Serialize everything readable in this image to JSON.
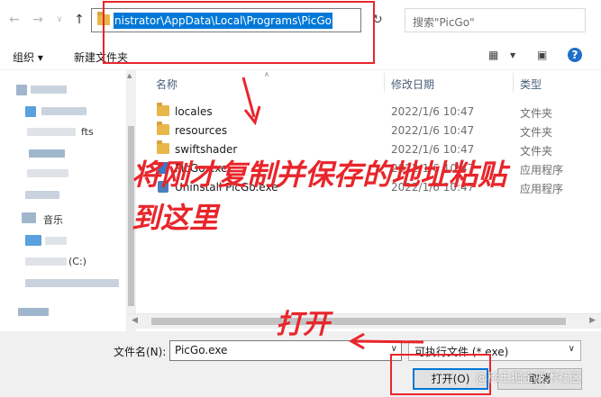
{
  "address": {
    "path": "nistrator\\AppData\\Local\\Programs\\PicGo",
    "search_placeholder": "搜索\"PicGo\""
  },
  "toolbar": {
    "organize": "组织 ▾",
    "new_folder": "新建文件夹"
  },
  "leftnav": {
    "visible_fragments": [
      "fts",
      "音乐",
      "(C:)"
    ]
  },
  "columns": {
    "name": "名称",
    "modified": "修改日期",
    "type": "类型"
  },
  "files": [
    {
      "name": "locales",
      "date": "2022/1/6 10:47",
      "type": "文件夹",
      "kind": "folder"
    },
    {
      "name": "resources",
      "date": "2022/1/6 10:47",
      "type": "文件夹",
      "kind": "folder"
    },
    {
      "name": "swiftshader",
      "date": "2022/1/6 10:47",
      "type": "文件夹",
      "kind": "folder"
    },
    {
      "name": "PicGo.exe",
      "date": "2022/1/6 10:47",
      "type": "应用程序",
      "kind": "exe"
    },
    {
      "name": "Uninstall PicGo.exe",
      "date": "2022/1/6 10:47",
      "type": "应用程序",
      "kind": "exe"
    }
  ],
  "bottom": {
    "filename_label": "文件名(N):",
    "filename_value": "PicGo.exe",
    "filetype_value": "可执行文件 (*.exe)",
    "open_button": "打开(O)",
    "cancel_button": "取消"
  },
  "annotations": {
    "paste_hint_line1": "将刚才复制并保存的地址粘贴",
    "paste_hint_line2": "到这里",
    "open_hint": "打开",
    "annotation_color": "#e8262b"
  },
  "watermark": "@稀土掘金技术社区",
  "colors": {
    "selection": "#0078d7",
    "folder": "#e8b74a",
    "header_text": "#4c607a"
  }
}
